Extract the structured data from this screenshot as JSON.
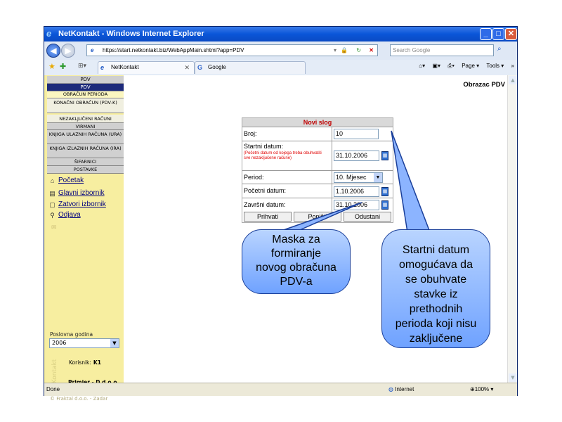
{
  "window": {
    "title": "NetKontakt - Windows Internet Explorer",
    "minimize_icon": "minimize-icon",
    "maximize_icon": "maximize-icon",
    "close_icon": "close-icon"
  },
  "browser": {
    "url": "https://start.netkontakt.biz/WebAppMain.shtml?app=PDV",
    "search_placeholder": "Search Google",
    "tabs": [
      {
        "label": "NetKontakt",
        "icon": "ie-page-icon"
      },
      {
        "label": "Google",
        "icon": "google-icon"
      }
    ],
    "tools": {
      "page": "Page",
      "tools": "Tools"
    },
    "status": {
      "left": "Done",
      "zone": "Internet",
      "zoom": "100%"
    }
  },
  "sidebar": {
    "top_label": "PDV",
    "selected_label": "PDV",
    "menu": [
      {
        "label": "OBRAČUN PERIODA",
        "highlight": true
      },
      {
        "label": "KONAČNI OBRAČUN (PDV-K)",
        "highlight": false
      },
      {
        "label": "NEZAKLJUČENI RAČUNI",
        "highlight": false
      },
      {
        "label": "VIRMANI",
        "highlight": false
      },
      {
        "label": "KNJIGA ULAZNIH RAČUNA (URA)",
        "highlight": false
      },
      {
        "label": "KNJIGA IZLAZNIH RAČUNA (IRA)",
        "highlight": false
      },
      {
        "label": "ŠIFARNICI",
        "highlight": false
      },
      {
        "label": "POSTAVKE",
        "highlight": false
      }
    ],
    "links": [
      {
        "label": "Početak",
        "icon": "home-icon"
      },
      {
        "label": "Glavni izbornik",
        "icon": "main-menu-icon"
      },
      {
        "label": "Zatvori izbornik",
        "icon": "close-menu-icon"
      },
      {
        "label": "Odjava",
        "icon": "logout-icon"
      }
    ],
    "year_label": "Poslovna godina",
    "year_value": "2006",
    "user_label": "Korisnik:",
    "user_value": "K1",
    "company": "Primjer - D d.o.o.",
    "copyright": "© Fraktal d.o.o. - Zadar"
  },
  "main": {
    "page_label": "Obrazac PDV",
    "form": {
      "title": "Novi slog",
      "broj_label": "Broj:",
      "broj_value": "10",
      "startni_label": "Startni datum:",
      "startni_note": "(Početni datum od kojega treba obuhvatiti sve nezaključene račune)",
      "startni_value": "31.10.2006",
      "period_label": "Period:",
      "period_value": "10. Mjesec",
      "pocetni_label": "Početni datum:",
      "pocetni_value": "1.10.2006",
      "zavrsni_label": "Završni datum:",
      "zavrsni_value": "31.10.2006",
      "buttons": {
        "accept": "Prihvati",
        "reset": "Poništi",
        "cancel": "Odustani"
      }
    }
  },
  "callouts": {
    "left": [
      "Maska za",
      "formiranje",
      "novog obračuna",
      "PDV-a"
    ],
    "right": [
      "Startni datum",
      "omogućava da",
      "se obuhvate",
      "stavke iz",
      "prethodnih",
      "perioda koji nisu",
      "zaključene"
    ]
  }
}
